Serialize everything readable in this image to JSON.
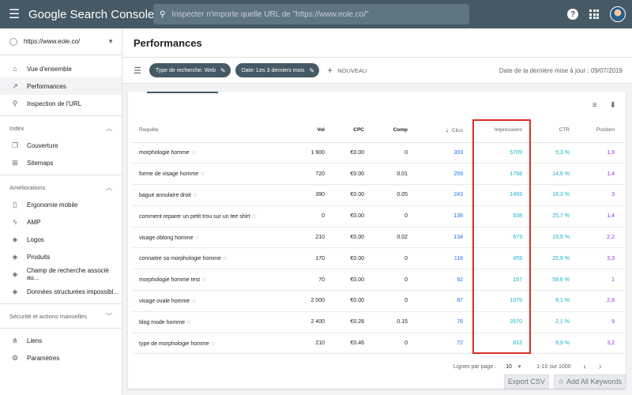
{
  "topbar": {
    "brand": "Google Search Console",
    "search_placeholder": "Inspecter n'importe quelle URL de \"https://www.eole.co/\""
  },
  "sidebar": {
    "property": "https://www.eole.co/",
    "items": [
      {
        "label": "Vue d'ensemble",
        "icon": "home-icon"
      },
      {
        "label": "Performances",
        "icon": "trending-icon"
      },
      {
        "label": "Inspection de l'URL",
        "icon": "search-icon"
      }
    ],
    "index_title": "Index",
    "index_items": [
      {
        "label": "Couverture",
        "icon": "copy-icon"
      },
      {
        "label": "Sitemaps",
        "icon": "sitemap-icon"
      }
    ],
    "improvements_title": "Améliorations",
    "improvements_items": [
      {
        "label": "Ergonomie mobile",
        "icon": "phone-icon"
      },
      {
        "label": "AMP",
        "icon": "bolt-icon"
      },
      {
        "label": "Logos",
        "icon": "layers-icon"
      },
      {
        "label": "Produits",
        "icon": "layers-icon"
      },
      {
        "label": "Champ de recherche associé au...",
        "icon": "layers-icon"
      },
      {
        "label": "Données structurées impossibl...",
        "icon": "layers-icon"
      }
    ],
    "security_title": "Sécurité et actions manuelles",
    "bottom_items": [
      {
        "label": "Liens",
        "icon": "links-icon"
      },
      {
        "label": "Paramètres",
        "icon": "gear-icon"
      }
    ]
  },
  "main": {
    "title": "Performances",
    "filters": {
      "chip1": "Type de recherche: Web",
      "chip2": "Date: Les 3 derniers mois",
      "new_label": "NOUVEAU",
      "last_update": "Date de la dernière mise à jour : 09/07/2019"
    },
    "table": {
      "headers": {
        "query": "Requête",
        "vol": "Vol",
        "cpc": "CPC",
        "comp": "Comp",
        "clicks": "Clics",
        "impressions": "Impressions",
        "ctr": "CTR",
        "position": "Position"
      },
      "rows": [
        {
          "query": "morphologie homme",
          "vol": "1 900",
          "cpc": "€0.00",
          "comp": "0",
          "clicks": "303",
          "impressions": "5709",
          "ctr": "5,3 %",
          "position": "1,9"
        },
        {
          "query": "forme de visage homme",
          "vol": "720",
          "cpc": "€0.00",
          "comp": "0.01",
          "clicks": "259",
          "impressions": "1768",
          "ctr": "14,6 %",
          "position": "1,4"
        },
        {
          "query": "bague annulaire droit",
          "vol": "390",
          "cpc": "€0.00",
          "comp": "0.05",
          "clicks": "243",
          "impressions": "1493",
          "ctr": "16,3 %",
          "position": "3"
        },
        {
          "query": "comment reparer un petit trou sur un tee shirt",
          "vol": "0",
          "cpc": "€0.00",
          "comp": "0",
          "clicks": "138",
          "impressions": "538",
          "ctr": "25,7 %",
          "position": "1,4"
        },
        {
          "query": "visage oblong homme",
          "vol": "210",
          "cpc": "€0.00",
          "comp": "0.02",
          "clicks": "134",
          "impressions": "673",
          "ctr": "19,9 %",
          "position": "2,2"
        },
        {
          "query": "connaitre sa morphologie homme",
          "vol": "170",
          "cpc": "€0.00",
          "comp": "0",
          "clicks": "118",
          "impressions": "455",
          "ctr": "25,9 %",
          "position": "3,3"
        },
        {
          "query": "morphologie homme test",
          "vol": "70",
          "cpc": "€0.00",
          "comp": "0",
          "clicks": "92",
          "impressions": "157",
          "ctr": "58,6 %",
          "position": "1"
        },
        {
          "query": "visage ovale homme",
          "vol": "2 000",
          "cpc": "€0.00",
          "comp": "0",
          "clicks": "87",
          "impressions": "1075",
          "ctr": "8,1 %",
          "position": "2,8"
        },
        {
          "query": "blog mode homme",
          "vol": "2 400",
          "cpc": "€0.28",
          "comp": "0.15",
          "clicks": "76",
          "impressions": "3570",
          "ctr": "2,1 %",
          "position": "9"
        },
        {
          "query": "type de morphologie homme",
          "vol": "210",
          "cpc": "€0.46",
          "comp": "0",
          "clicks": "72",
          "impressions": "813",
          "ctr": "8,9 %",
          "position": "3,2"
        }
      ]
    },
    "pagination": {
      "rows_label": "Lignes par page :",
      "rows_value": "10",
      "range": "1-10 sur 1000"
    }
  },
  "bottom_buttons": {
    "export": "Export CSV",
    "add_keywords": "Add All Keywords"
  }
}
